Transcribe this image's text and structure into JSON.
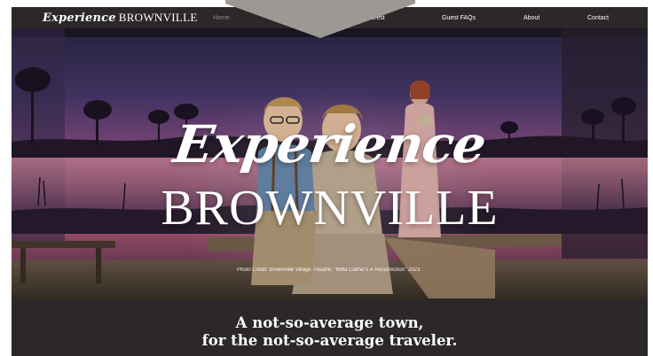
{
  "brand": {
    "script": "Experience",
    "caps": "BROWNVILLE"
  },
  "nav": {
    "home": "Home",
    "interest": "by Interest",
    "faqs": "Guest FAQs",
    "about": "About",
    "contact": "Contact"
  },
  "hero": {
    "title_script": "Experience",
    "title_caps": "BROWNVILLE",
    "photo_credit": "Photo Credit: Brownville Village Theatre, \"Willa Cather's A Resurrection\" 2023"
  },
  "tagline": {
    "line1": "A not-so-average town,",
    "line2": "for the not-so-average traveler."
  },
  "colors": {
    "nav_background": "#2b2827",
    "page_background": "#ffffff",
    "active_nav": "#8e8a88",
    "dropdown_tab": "#9c9896"
  }
}
